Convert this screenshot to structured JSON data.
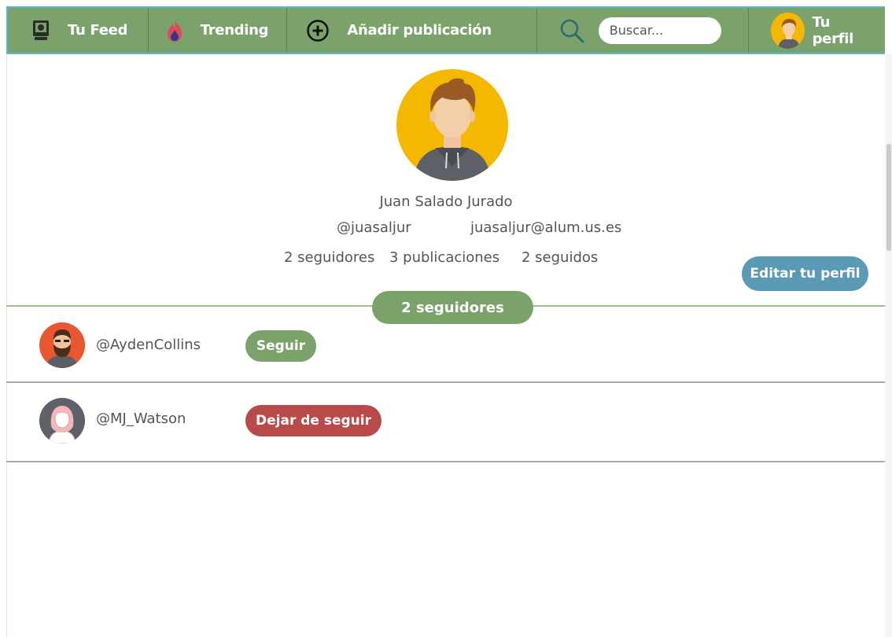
{
  "nav": {
    "feed_label": "Tu Feed",
    "trending_label": "Trending",
    "add_label": "Añadir publicación",
    "search_placeholder": "Buscar...",
    "profile_label": "Tu perfil",
    "icons": [
      "monitor-icon",
      "flame-icon",
      "plus-circle-icon",
      "search-icon",
      "avatar"
    ]
  },
  "profile": {
    "name": "Juan Salado Jurado",
    "handle": "@juasaljur",
    "email": "juasaljur@alum.us.es",
    "followers": "2 seguidores",
    "posts": "3 publicaciones",
    "following": "2 seguidos",
    "edit_label": "Editar tu perfil"
  },
  "section": {
    "title": "2 seguidores"
  },
  "followers": [
    {
      "handle": "@AydenCollins",
      "action": "Seguir"
    },
    {
      "handle": "@MJ_Watson",
      "action": "Dejar de seguir"
    }
  ],
  "colors": {
    "nav_green": "#7ba26b",
    "accent_blue": "#5a9ab4",
    "danger_red": "#b94a4a",
    "avatar_yellow": "#f5b800"
  }
}
